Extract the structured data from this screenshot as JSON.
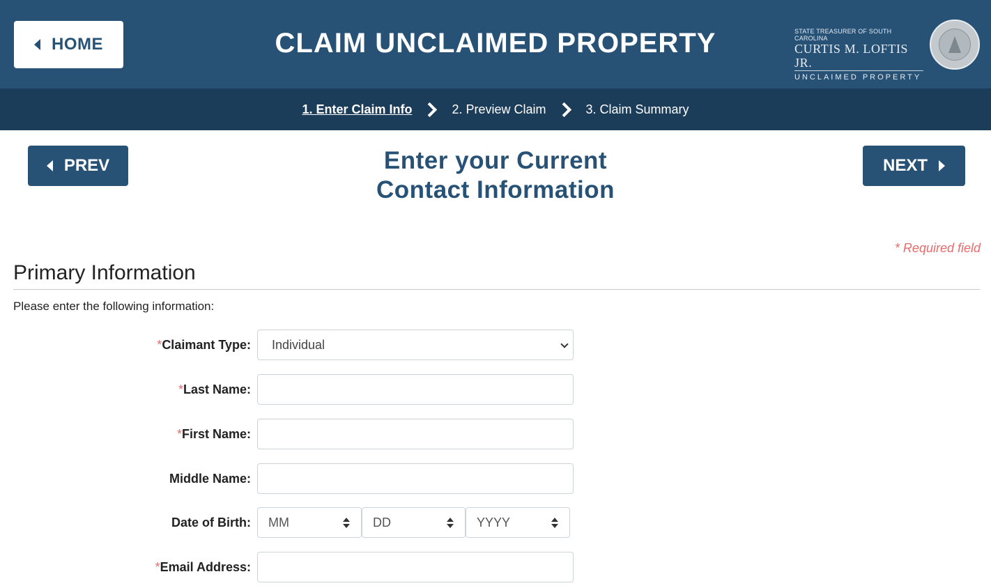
{
  "header": {
    "home_label": "HOME",
    "title": "CLAIM UNCLAIMED PROPERTY",
    "logo": {
      "line1": "STATE TREASURER OF SOUTH CAROLINA",
      "line2": "CURTIS M. LOFTIS JR.",
      "line3": "UNCLAIMED PROPERTY",
      "seal_icon": "state-treasurer-seal-icon"
    }
  },
  "steps": [
    {
      "label": "1. Enter Claim Info",
      "active": true
    },
    {
      "label": "2. Preview Claim",
      "active": false
    },
    {
      "label": "3. Claim Summary",
      "active": false
    }
  ],
  "nav": {
    "prev_label": "PREV",
    "next_label": "NEXT"
  },
  "page": {
    "heading_line1": "Enter your Current",
    "heading_line2": "Contact Information",
    "required_note": "* Required field"
  },
  "section": {
    "title": "Primary Information",
    "instructions": "Please enter the following information:"
  },
  "form": {
    "claimant_type": {
      "label": "Claimant Type:",
      "required": "*",
      "value": "Individual"
    },
    "last_name": {
      "label": "Last Name:",
      "required": "*",
      "value": ""
    },
    "first_name": {
      "label": "First Name:",
      "required": "*",
      "value": ""
    },
    "middle_name": {
      "label": "Middle Name:",
      "value": ""
    },
    "dob": {
      "label": "Date of Birth:",
      "month": "MM",
      "day": "DD",
      "year": "YYYY"
    },
    "email": {
      "label": "Email Address:",
      "required": "*",
      "value": ""
    }
  },
  "colors": {
    "header": "#275276",
    "stepbar": "#1c3d5a",
    "required": "#e66c6c"
  }
}
